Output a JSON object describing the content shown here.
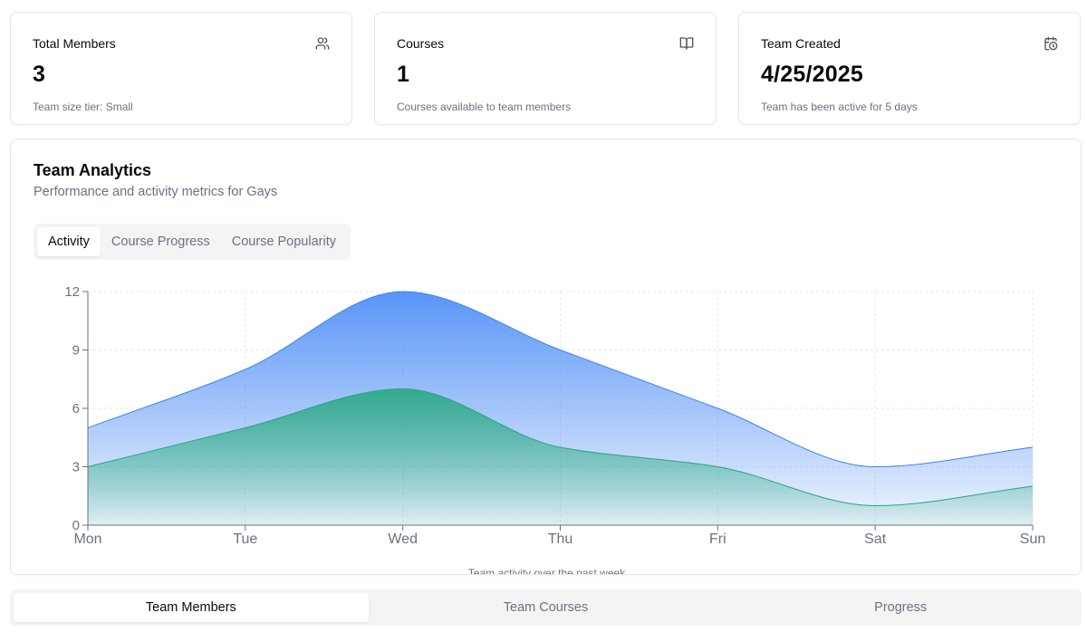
{
  "stats": [
    {
      "title": "Total Members",
      "value": "3",
      "sub": "Team size tier: Small",
      "icon": "users-icon"
    },
    {
      "title": "Courses",
      "value": "1",
      "sub": "Courses available to team members",
      "icon": "book-open-icon"
    },
    {
      "title": "Team Created",
      "value": "4/25/2025",
      "sub": "Team has been active for 5 days",
      "icon": "calendar-clock-icon"
    }
  ],
  "analytics": {
    "title": "Team Analytics",
    "subtitle": "Performance and activity metrics for Gays",
    "tabs": [
      "Activity",
      "Course Progress",
      "Course Popularity"
    ],
    "active_tab": "Activity",
    "caption": "Team activity over the past week"
  },
  "colors": {
    "blue_series": "#3b82f6",
    "green_series": "#22a87a",
    "grid": "#e5e7eb"
  },
  "chart_data": {
    "type": "area",
    "categories": [
      "Mon",
      "Tue",
      "Wed",
      "Thu",
      "Fri",
      "Sat",
      "Sun"
    ],
    "series": [
      {
        "values": [
          5,
          8,
          12,
          9,
          6,
          3,
          4
        ]
      },
      {
        "values": [
          3,
          5,
          7,
          4,
          3,
          1,
          2
        ]
      }
    ],
    "yticks": [
      0,
      3,
      6,
      9,
      12
    ],
    "ylim": [
      0,
      12
    ],
    "grid": true,
    "legend": "none"
  },
  "bottom_tabs": [
    "Team Members",
    "Team Courses",
    "Progress"
  ],
  "bottom_active": "Team Members"
}
